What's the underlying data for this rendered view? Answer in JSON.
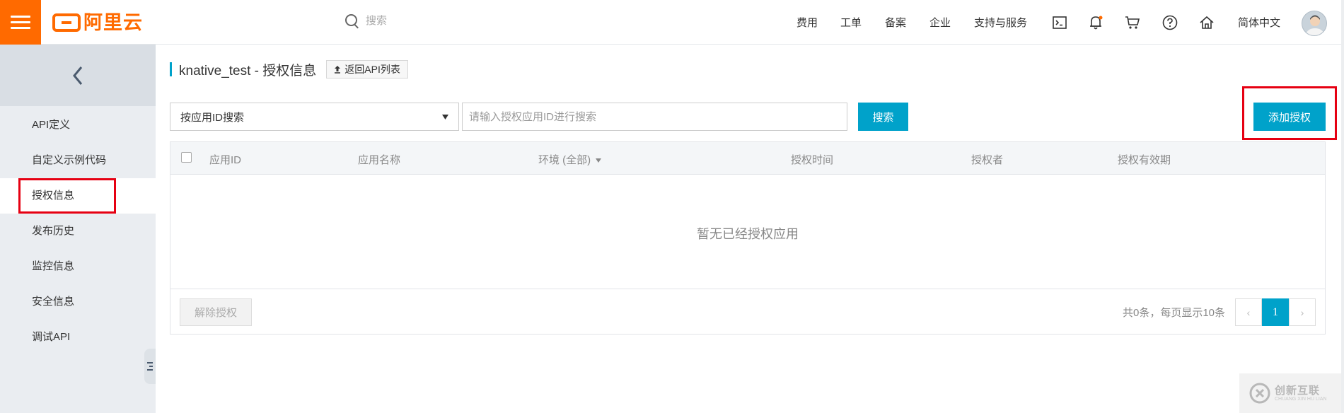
{
  "topbar": {
    "logo_text": "阿里云",
    "search_placeholder": "搜索",
    "nav": [
      "费用",
      "工单",
      "备案",
      "企业",
      "支持与服务"
    ],
    "icons": [
      "terminal-icon",
      "bell-icon",
      "cart-icon",
      "help-icon",
      "home-icon"
    ],
    "language": "简体中文",
    "accent_color": "#ff6a00"
  },
  "sidebar": {
    "items": [
      {
        "label": "API定义"
      },
      {
        "label": "自定义示例代码"
      },
      {
        "label": "授权信息"
      },
      {
        "label": "发布历史"
      },
      {
        "label": "监控信息"
      },
      {
        "label": "安全信息"
      },
      {
        "label": "调试API"
      }
    ],
    "active_index": 2
  },
  "page": {
    "title": "knative_test - 授权信息",
    "back_button": "返回API列表"
  },
  "filter": {
    "select_value": "按应用ID搜索",
    "input_value": "",
    "input_placeholder": "请输入授权应用ID进行搜索",
    "search_button": "搜索",
    "add_button": "添加授权"
  },
  "table": {
    "columns": [
      "应用ID",
      "应用名称",
      "环境 (全部)",
      "授权时间",
      "授权者",
      "授权有效期"
    ],
    "empty_text": "暂无已经授权应用",
    "unauthorize_button": "解除授权",
    "total_text": "共0条，每页显示10条",
    "pagination": {
      "prev": "‹",
      "current": "1",
      "next": "›"
    }
  },
  "watermark": {
    "text": "创新互联",
    "sub": "CHUANG XIN HU LIAN"
  },
  "colors": {
    "primary": "#00a2ca",
    "highlight": "#e60012"
  }
}
